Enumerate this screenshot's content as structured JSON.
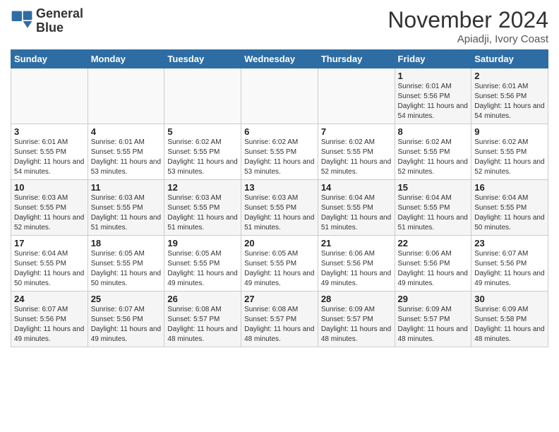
{
  "header": {
    "logo_line1": "General",
    "logo_line2": "Blue",
    "month_title": "November 2024",
    "location": "Apiadji, Ivory Coast"
  },
  "weekdays": [
    "Sunday",
    "Monday",
    "Tuesday",
    "Wednesday",
    "Thursday",
    "Friday",
    "Saturday"
  ],
  "weeks": [
    [
      {
        "day": "",
        "sunrise": "",
        "sunset": "",
        "daylight": ""
      },
      {
        "day": "",
        "sunrise": "",
        "sunset": "",
        "daylight": ""
      },
      {
        "day": "",
        "sunrise": "",
        "sunset": "",
        "daylight": ""
      },
      {
        "day": "",
        "sunrise": "",
        "sunset": "",
        "daylight": ""
      },
      {
        "day": "",
        "sunrise": "",
        "sunset": "",
        "daylight": ""
      },
      {
        "day": "1",
        "sunrise": "Sunrise: 6:01 AM",
        "sunset": "Sunset: 5:56 PM",
        "daylight": "Daylight: 11 hours and 54 minutes."
      },
      {
        "day": "2",
        "sunrise": "Sunrise: 6:01 AM",
        "sunset": "Sunset: 5:56 PM",
        "daylight": "Daylight: 11 hours and 54 minutes."
      }
    ],
    [
      {
        "day": "3",
        "sunrise": "Sunrise: 6:01 AM",
        "sunset": "Sunset: 5:55 PM",
        "daylight": "Daylight: 11 hours and 54 minutes."
      },
      {
        "day": "4",
        "sunrise": "Sunrise: 6:01 AM",
        "sunset": "Sunset: 5:55 PM",
        "daylight": "Daylight: 11 hours and 53 minutes."
      },
      {
        "day": "5",
        "sunrise": "Sunrise: 6:02 AM",
        "sunset": "Sunset: 5:55 PM",
        "daylight": "Daylight: 11 hours and 53 minutes."
      },
      {
        "day": "6",
        "sunrise": "Sunrise: 6:02 AM",
        "sunset": "Sunset: 5:55 PM",
        "daylight": "Daylight: 11 hours and 53 minutes."
      },
      {
        "day": "7",
        "sunrise": "Sunrise: 6:02 AM",
        "sunset": "Sunset: 5:55 PM",
        "daylight": "Daylight: 11 hours and 52 minutes."
      },
      {
        "day": "8",
        "sunrise": "Sunrise: 6:02 AM",
        "sunset": "Sunset: 5:55 PM",
        "daylight": "Daylight: 11 hours and 52 minutes."
      },
      {
        "day": "9",
        "sunrise": "Sunrise: 6:02 AM",
        "sunset": "Sunset: 5:55 PM",
        "daylight": "Daylight: 11 hours and 52 minutes."
      }
    ],
    [
      {
        "day": "10",
        "sunrise": "Sunrise: 6:03 AM",
        "sunset": "Sunset: 5:55 PM",
        "daylight": "Daylight: 11 hours and 52 minutes."
      },
      {
        "day": "11",
        "sunrise": "Sunrise: 6:03 AM",
        "sunset": "Sunset: 5:55 PM",
        "daylight": "Daylight: 11 hours and 51 minutes."
      },
      {
        "day": "12",
        "sunrise": "Sunrise: 6:03 AM",
        "sunset": "Sunset: 5:55 PM",
        "daylight": "Daylight: 11 hours and 51 minutes."
      },
      {
        "day": "13",
        "sunrise": "Sunrise: 6:03 AM",
        "sunset": "Sunset: 5:55 PM",
        "daylight": "Daylight: 11 hours and 51 minutes."
      },
      {
        "day": "14",
        "sunrise": "Sunrise: 6:04 AM",
        "sunset": "Sunset: 5:55 PM",
        "daylight": "Daylight: 11 hours and 51 minutes."
      },
      {
        "day": "15",
        "sunrise": "Sunrise: 6:04 AM",
        "sunset": "Sunset: 5:55 PM",
        "daylight": "Daylight: 11 hours and 51 minutes."
      },
      {
        "day": "16",
        "sunrise": "Sunrise: 6:04 AM",
        "sunset": "Sunset: 5:55 PM",
        "daylight": "Daylight: 11 hours and 50 minutes."
      }
    ],
    [
      {
        "day": "17",
        "sunrise": "Sunrise: 6:04 AM",
        "sunset": "Sunset: 5:55 PM",
        "daylight": "Daylight: 11 hours and 50 minutes."
      },
      {
        "day": "18",
        "sunrise": "Sunrise: 6:05 AM",
        "sunset": "Sunset: 5:55 PM",
        "daylight": "Daylight: 11 hours and 50 minutes."
      },
      {
        "day": "19",
        "sunrise": "Sunrise: 6:05 AM",
        "sunset": "Sunset: 5:55 PM",
        "daylight": "Daylight: 11 hours and 49 minutes."
      },
      {
        "day": "20",
        "sunrise": "Sunrise: 6:05 AM",
        "sunset": "Sunset: 5:55 PM",
        "daylight": "Daylight: 11 hours and 49 minutes."
      },
      {
        "day": "21",
        "sunrise": "Sunrise: 6:06 AM",
        "sunset": "Sunset: 5:56 PM",
        "daylight": "Daylight: 11 hours and 49 minutes."
      },
      {
        "day": "22",
        "sunrise": "Sunrise: 6:06 AM",
        "sunset": "Sunset: 5:56 PM",
        "daylight": "Daylight: 11 hours and 49 minutes."
      },
      {
        "day": "23",
        "sunrise": "Sunrise: 6:07 AM",
        "sunset": "Sunset: 5:56 PM",
        "daylight": "Daylight: 11 hours and 49 minutes."
      }
    ],
    [
      {
        "day": "24",
        "sunrise": "Sunrise: 6:07 AM",
        "sunset": "Sunset: 5:56 PM",
        "daylight": "Daylight: 11 hours and 49 minutes."
      },
      {
        "day": "25",
        "sunrise": "Sunrise: 6:07 AM",
        "sunset": "Sunset: 5:56 PM",
        "daylight": "Daylight: 11 hours and 49 minutes."
      },
      {
        "day": "26",
        "sunrise": "Sunrise: 6:08 AM",
        "sunset": "Sunset: 5:57 PM",
        "daylight": "Daylight: 11 hours and 48 minutes."
      },
      {
        "day": "27",
        "sunrise": "Sunrise: 6:08 AM",
        "sunset": "Sunset: 5:57 PM",
        "daylight": "Daylight: 11 hours and 48 minutes."
      },
      {
        "day": "28",
        "sunrise": "Sunrise: 6:09 AM",
        "sunset": "Sunset: 5:57 PM",
        "daylight": "Daylight: 11 hours and 48 minutes."
      },
      {
        "day": "29",
        "sunrise": "Sunrise: 6:09 AM",
        "sunset": "Sunset: 5:57 PM",
        "daylight": "Daylight: 11 hours and 48 minutes."
      },
      {
        "day": "30",
        "sunrise": "Sunrise: 6:09 AM",
        "sunset": "Sunset: 5:58 PM",
        "daylight": "Daylight: 11 hours and 48 minutes."
      }
    ]
  ]
}
